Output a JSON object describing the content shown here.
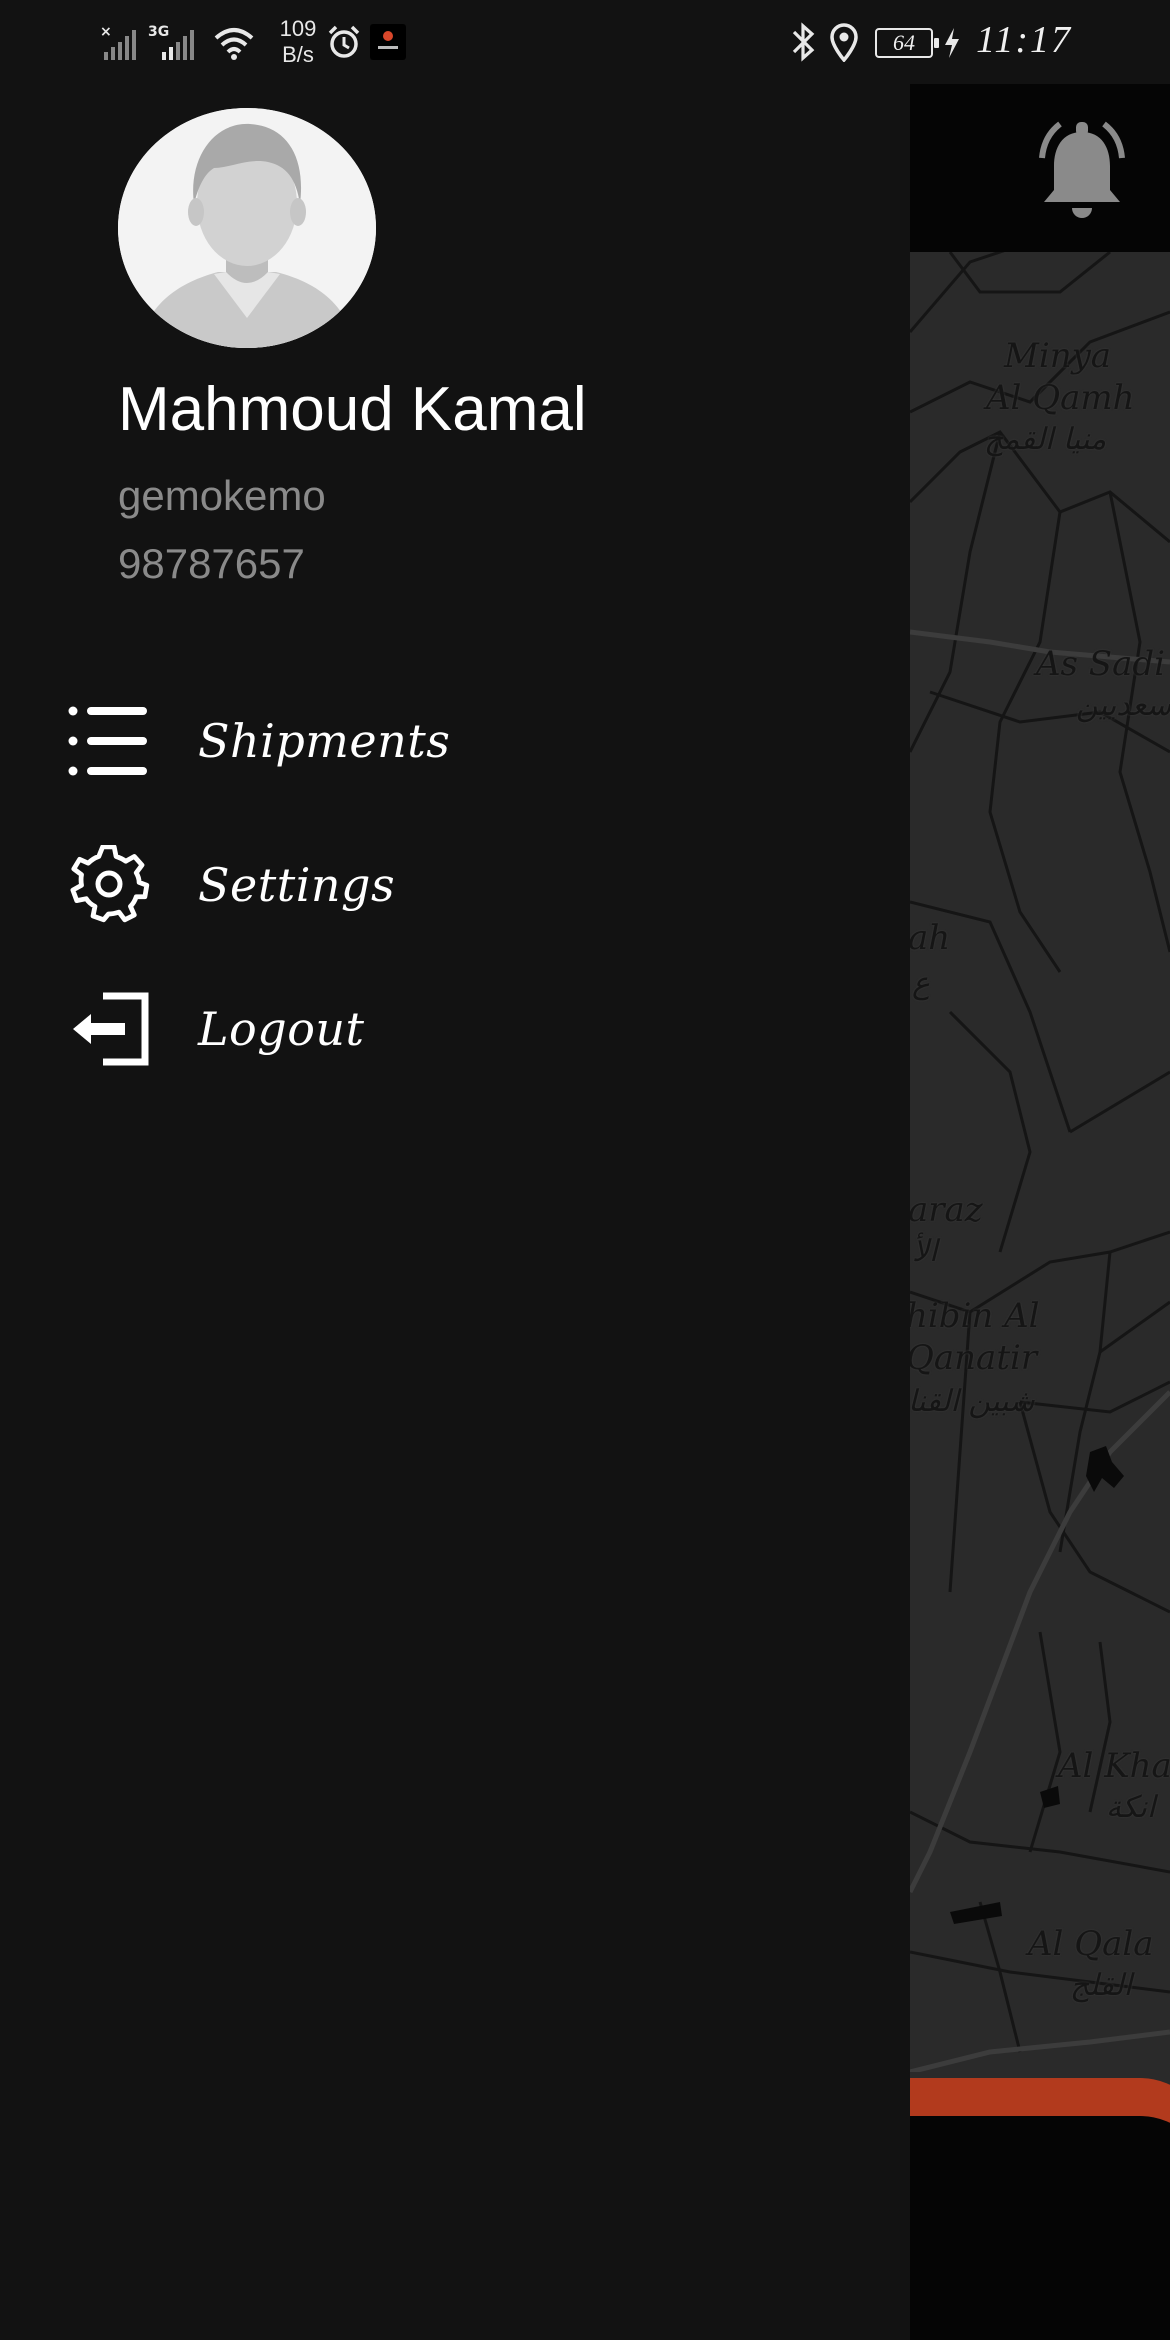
{
  "status_bar": {
    "net_speed_value": "109",
    "net_speed_unit": "B/s",
    "battery_level": "64",
    "time": "11:17",
    "icons": [
      "signal-x-icon",
      "signal-3g-icon",
      "wifi-icon",
      "alarm-icon",
      "app-notification-icon",
      "bluetooth-icon",
      "location-icon",
      "battery-icon",
      "charging-icon"
    ]
  },
  "drawer": {
    "user": {
      "name": "Mahmoud Kamal",
      "login": "gemokemo",
      "phone": "98787657",
      "avatar_icon": "person-avatar-icon"
    },
    "menu": [
      {
        "label": "Shipments",
        "icon": "list-icon"
      },
      {
        "label": "Settings",
        "icon": "gear-icon"
      },
      {
        "label": "Logout",
        "icon": "logout-icon"
      }
    ]
  },
  "map": {
    "labels": [
      {
        "en": "Minya",
        "ar": ""
      },
      {
        "en": "Al Qamh",
        "ar": "منيا القمح"
      },
      {
        "en": "As Sadi",
        "ar": "سعديين"
      },
      {
        "en": "ah",
        "ar": "ع"
      },
      {
        "en": "araz",
        "ar": "الأ"
      },
      {
        "en": "hibin Al",
        "ar": ""
      },
      {
        "en": "Qanatir",
        "ar": "شبين القنا"
      },
      {
        "en": "Al Kha",
        "ar": "انكة"
      },
      {
        "en": "Al Qala",
        "ar": "القلج"
      }
    ],
    "bell_icon": "notification-bell-icon"
  },
  "colors": {
    "drawer_bg": "#121212",
    "map_bg": "#2a2a2a",
    "accent_orange": "#b23a1d",
    "text_primary": "#ffffff",
    "text_secondary": "#8a8a8a"
  }
}
